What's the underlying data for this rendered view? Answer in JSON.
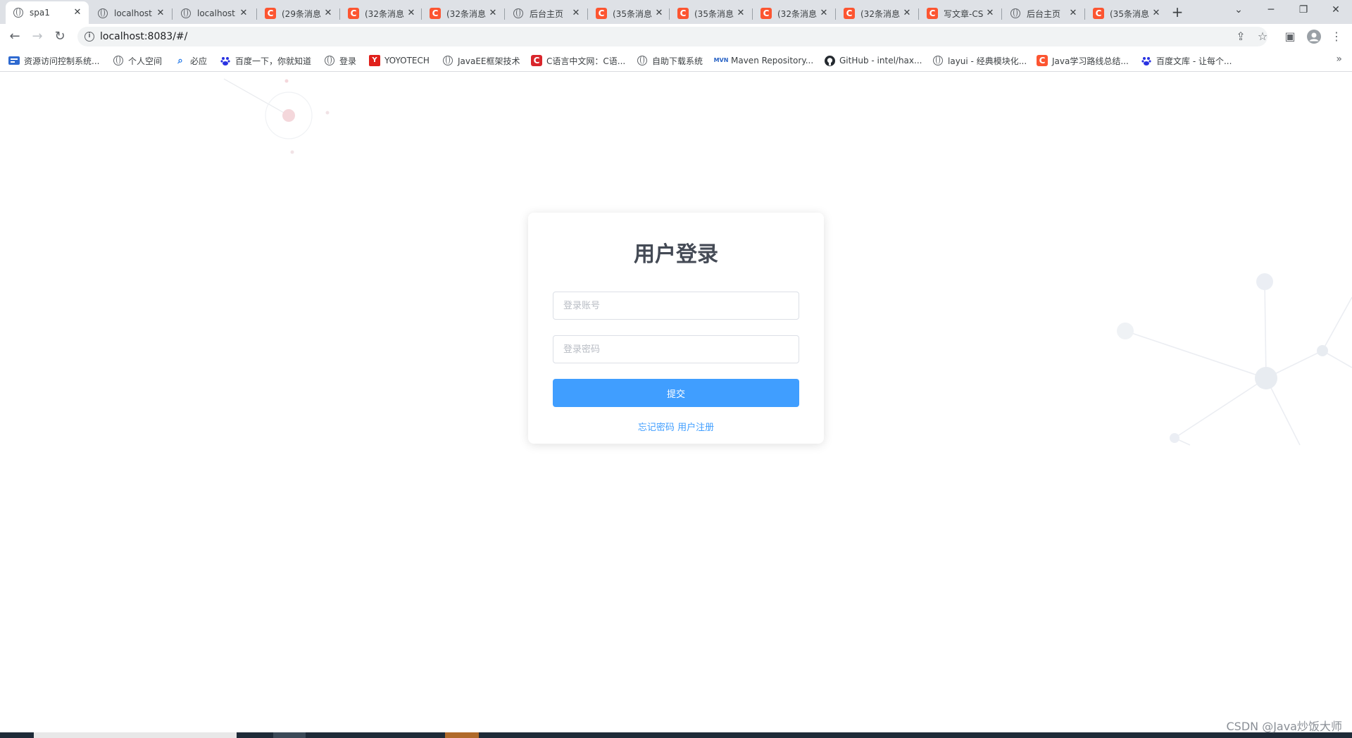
{
  "browser": {
    "tabs": [
      {
        "label": "spa1",
        "icon": "globe-icon",
        "active": true
      },
      {
        "label": "localhost",
        "icon": "globe-icon"
      },
      {
        "label": "localhost",
        "icon": "globe-icon"
      },
      {
        "label": "(29条消息",
        "icon": "csdn-icon"
      },
      {
        "label": "(32条消息",
        "icon": "csdn-icon"
      },
      {
        "label": "(32条消息",
        "icon": "csdn-icon"
      },
      {
        "label": "后台主页",
        "icon": "globe-icon"
      },
      {
        "label": "(35条消息",
        "icon": "csdn-icon"
      },
      {
        "label": "(35条消息",
        "icon": "csdn-icon"
      },
      {
        "label": "(32条消息",
        "icon": "csdn-icon"
      },
      {
        "label": "(32条消息",
        "icon": "csdn-icon"
      },
      {
        "label": "写文章-CS",
        "icon": "csdn-icon"
      },
      {
        "label": "后台主页",
        "icon": "globe-icon"
      },
      {
        "label": "(35条消息",
        "icon": "csdn-icon"
      }
    ],
    "tab_close_glyph": "✕",
    "new_tab_glyph": "+",
    "url": "localhost:8083/#/",
    "bookmarks": [
      {
        "label": "资源访问控制系统...",
        "icon": "app-icon"
      },
      {
        "label": "个人空间",
        "icon": "globe-icon"
      },
      {
        "label": "必应",
        "icon": "search-icon"
      },
      {
        "label": "百度一下，你就知道",
        "icon": "baidu-icon"
      },
      {
        "label": "登录",
        "icon": "globe-icon"
      },
      {
        "label": "YOYOTECH",
        "icon": "yoyotech-icon"
      },
      {
        "label": "JavaEE框架技术",
        "icon": "globe-icon"
      },
      {
        "label": "C语言中文网：C语...",
        "icon": "c-icon"
      },
      {
        "label": "自助下载系统",
        "icon": "globe-icon"
      },
      {
        "label": "Maven Repository...",
        "icon": "maven-icon"
      },
      {
        "label": "GitHub - intel/hax...",
        "icon": "github-icon"
      },
      {
        "label": "layui - 经典模块化...",
        "icon": "globe-icon"
      },
      {
        "label": "Java学习路线总结...",
        "icon": "csdn-icon"
      },
      {
        "label": "百度文库 - 让每个...",
        "icon": "baidu-icon"
      }
    ],
    "bookmarks_more": "»"
  },
  "login": {
    "title": "用户登录",
    "username_placeholder": "登录账号",
    "password_placeholder": "登录密码",
    "username_value": "",
    "password_value": "",
    "submit_label": "提交",
    "forgot_label": "忘记密码",
    "register_label": "用户注册"
  },
  "watermark": "CSDN @Java炒饭大师",
  "colors": {
    "primary": "#409eff",
    "title": "#444a55",
    "csdn": "#fc5531"
  }
}
